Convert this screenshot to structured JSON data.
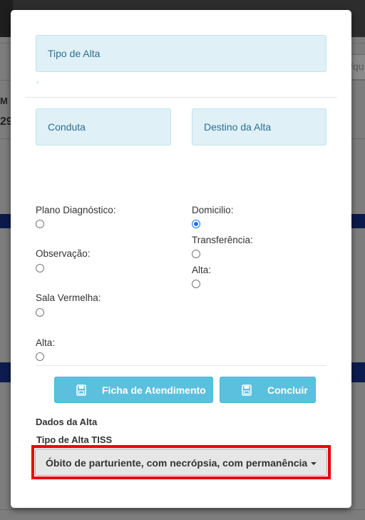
{
  "background": {
    "left_labels": [
      "M",
      "29"
    ],
    "right_input_fragment": "/qu"
  },
  "modal": {
    "tipo_alta_label": "Tipo de Alta",
    "conduta_label": "Conduta",
    "destino_alta_label": "Destino da Alta",
    "conduta_options": [
      {
        "label": "Plano Diagnóstico:",
        "checked": false
      },
      {
        "label": "Observação:",
        "checked": false
      },
      {
        "label": "Sala Vermelha:",
        "checked": false
      },
      {
        "label": "Alta:",
        "checked": false
      }
    ],
    "destino_options": [
      {
        "label": "Domicilio:",
        "checked": true
      },
      {
        "label": "Transferência:",
        "checked": false
      },
      {
        "label": "Alta:",
        "checked": false
      }
    ],
    "buttons": {
      "ficha": "Ficha de Atendimento",
      "concluir": "Concluir"
    },
    "dados_alta_title": "Dados da Alta",
    "tipo_alta_tiss_title": "Tipo de Alta TISS",
    "tipo_alta_tiss_selected": "Óbito de parturiente, com necrópsia, com permanência"
  },
  "colors": {
    "info_box": "#dff0f7",
    "info_text": "#2e6f93",
    "button": "#5bc0de",
    "highlight": "#e8000b",
    "radio_checked": "#1a73e8"
  },
  "icons": {
    "button_icon": "floppy-disk-icon",
    "caret": "caret-down-icon"
  }
}
